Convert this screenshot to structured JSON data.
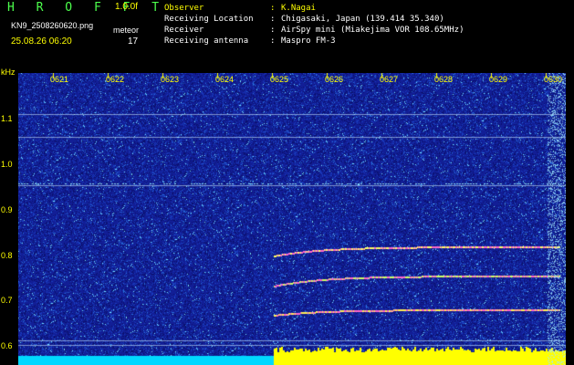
{
  "header": {
    "title": "H R O F F T",
    "version": "1.0.0f",
    "filename": "KN9_2508260620.png",
    "mode": "meteor",
    "datetime": "25.08.26 06:20",
    "count": "17",
    "rows": [
      {
        "label": "Observer",
        "value": "K.Nagai"
      },
      {
        "label": "Receiving Location",
        "value": "Chigasaki, Japan (139.414 35.340)"
      },
      {
        "label": "Receiver",
        "value": "AirSpy mini (Miakejima VOR 108.65MHz)"
      },
      {
        "label": "Receiving antenna",
        "value": "Maspro FM-3"
      }
    ],
    "separator": ":"
  },
  "axes": {
    "y_unit": "kHz",
    "y_ticks": [
      "1.1",
      "1.0",
      "0.9",
      "0.8",
      "0.7",
      "0.6"
    ],
    "x_ticks": [
      "0621",
      "0622",
      "0623",
      "0624",
      "0625",
      "0626",
      "0627",
      "0628",
      "0629",
      "0630"
    ]
  },
  "colors": {
    "background": "#1a2aa0",
    "axis_text": "#ffff00",
    "baseline_left": "#00d8ff",
    "baseline_right": "#ffff00"
  }
}
